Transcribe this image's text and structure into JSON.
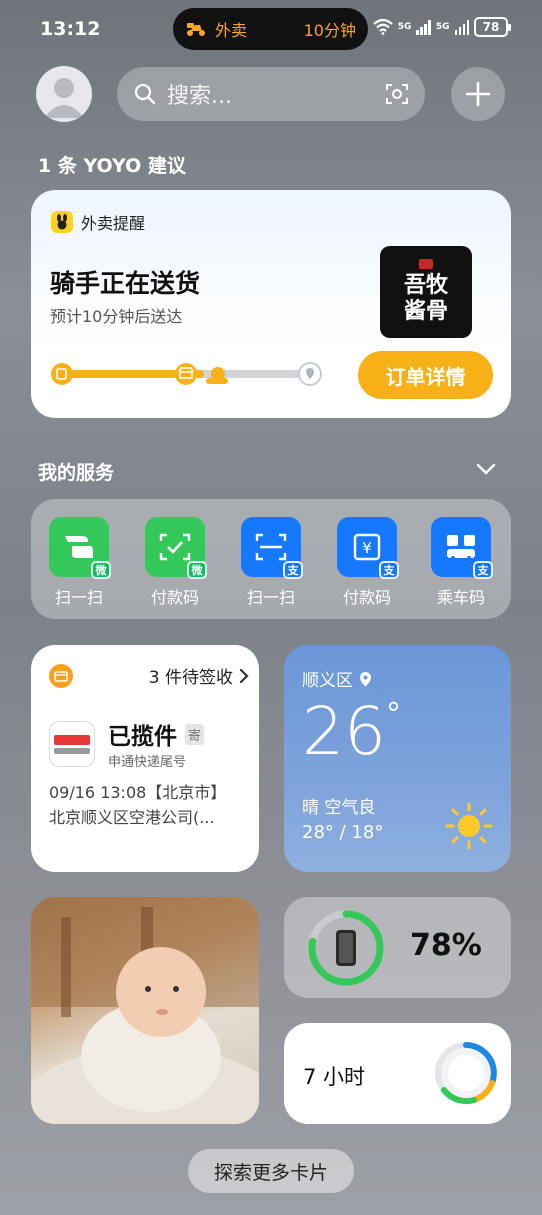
{
  "status_bar": {
    "time": "13:12",
    "island_label": "外卖",
    "island_eta": "10分钟",
    "network_1": "5G",
    "network_2": "5G",
    "battery": "78"
  },
  "search": {
    "placeholder": "搜索..."
  },
  "suggestion_header": "1 条 YOYO 建议",
  "delivery_card": {
    "app_name": "外卖提醒",
    "title": "骑手正在送货",
    "subtitle": "预计10分钟后送达",
    "shop_name": "吾牧酱骨",
    "progress": 0.55,
    "button_label": "订单详情"
  },
  "services": {
    "title": "我的服务",
    "items": [
      {
        "label": "扫一扫",
        "provider": "wechat",
        "badge": "微"
      },
      {
        "label": "付款码",
        "provider": "wechat",
        "badge": "微"
      },
      {
        "label": "扫一扫",
        "provider": "alipay",
        "badge": "支"
      },
      {
        "label": "付款码",
        "provider": "alipay",
        "badge": "支"
      },
      {
        "label": "乘车码",
        "provider": "alipay",
        "badge": "支"
      }
    ]
  },
  "parcel_card": {
    "pending": "3 件待签收",
    "status": "已揽件",
    "tag": "寄",
    "carrier": "申通快递尾号",
    "detail_line1": "09/16 13:08【北京市】",
    "detail_line2": "北京顺义区空港公司(..."
  },
  "weather_card": {
    "location": "顺义区",
    "temperature": "26",
    "degree": "°",
    "condition": "晴  空气良",
    "range": "28° / 18°"
  },
  "battery_card": {
    "percent_label": "78%",
    "level": 0.78
  },
  "screen_time_card": {
    "label": "7 小时"
  },
  "explore_button": "探索更多卡片",
  "colors": {
    "accent_orange": "#f7b016",
    "wechat_green": "#34c759",
    "alipay_blue": "#1677ff",
    "battery_green": "#34c759"
  }
}
